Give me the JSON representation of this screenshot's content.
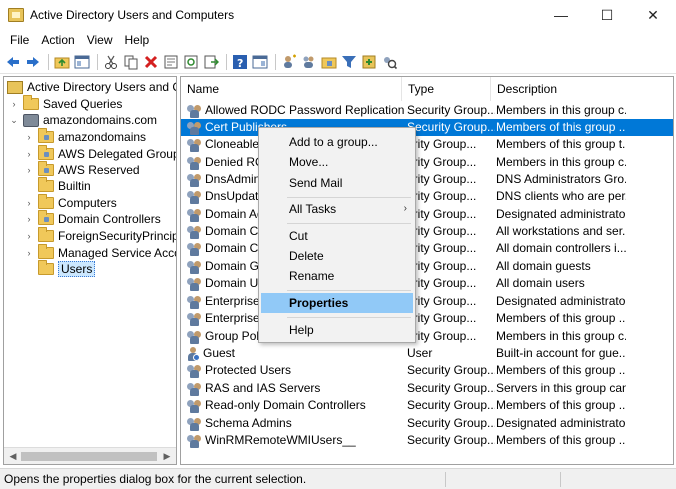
{
  "window": {
    "title": "Active Directory Users and Computers",
    "minimize": "—",
    "maximize": "☐",
    "close": "✕"
  },
  "menu": [
    "File",
    "Action",
    "View",
    "Help"
  ],
  "toolbar_icons": [
    "back-arrow-icon",
    "forward-arrow-icon",
    "up-folder-icon",
    "show-hide-tree-icon",
    "cut-icon",
    "copy-icon",
    "delete-icon",
    "properties-icon",
    "refresh-icon",
    "export-list-icon",
    "help-icon",
    "console-tree-icon",
    "new-user-icon",
    "new-group-icon",
    "new-ou-icon",
    "filter-icon",
    "add-to-group-icon",
    "find-icon"
  ],
  "tree": {
    "root": "Active Directory Users and Com",
    "items": [
      {
        "label": "Saved Queries"
      },
      {
        "label": "amazondomains.com"
      },
      {
        "label": "amazondomains"
      },
      {
        "label": "AWS Delegated Groups"
      },
      {
        "label": "AWS Reserved"
      },
      {
        "label": "Builtin"
      },
      {
        "label": "Computers"
      },
      {
        "label": "Domain Controllers"
      },
      {
        "label": "ForeignSecurityPrincipals"
      },
      {
        "label": "Managed Service Accour"
      },
      {
        "label": "Users"
      }
    ]
  },
  "list": {
    "columns": [
      "Name",
      "Type",
      "Description"
    ],
    "rows": [
      {
        "name": "Allowed RODC Password Replication Gr...",
        "type": "Security Group...",
        "desc": "Members in this group c..."
      },
      {
        "name": "Cert Publishers",
        "type": "Security Group...",
        "desc": "Members of this group ..."
      },
      {
        "name": "Cloneable D",
        "type": "urity Group...",
        "desc": "Members of this group t..."
      },
      {
        "name": "Denied ROD",
        "type": "urity Group...",
        "desc": "Members in this group c..."
      },
      {
        "name": "DnsAdmins",
        "type": "urity Group...",
        "desc": "DNS Administrators Gro..."
      },
      {
        "name": "DnsUpdateP",
        "type": "urity Group...",
        "desc": "DNS clients who are per..."
      },
      {
        "name": "Domain Adr",
        "type": "urity Group...",
        "desc": "Designated administrato..."
      },
      {
        "name": "Domain Cor",
        "type": "urity Group...",
        "desc": "All workstations and ser..."
      },
      {
        "name": "Domain Cor",
        "type": "urity Group...",
        "desc": "All domain controllers i..."
      },
      {
        "name": "Domain Gue",
        "type": "urity Group...",
        "desc": "All domain guests"
      },
      {
        "name": "Domain Use",
        "type": "urity Group...",
        "desc": "All domain users"
      },
      {
        "name": "Enterprise A",
        "type": "urity Group...",
        "desc": "Designated administrato..."
      },
      {
        "name": "Enterprise R",
        "type": "urity Group...",
        "desc": "Members of this group ..."
      },
      {
        "name": "Group Polic",
        "type": "urity Group...",
        "desc": "Members in this group c..."
      },
      {
        "name": "Guest",
        "type": "User",
        "desc": "Built-in account for gue..."
      },
      {
        "name": "Protected Users",
        "type": "Security Group...",
        "desc": "Members of this group ..."
      },
      {
        "name": "RAS and IAS Servers",
        "type": "Security Group...",
        "desc": "Servers in this group can..."
      },
      {
        "name": "Read-only Domain Controllers",
        "type": "Security Group...",
        "desc": "Members of this group ..."
      },
      {
        "name": "Schema Admins",
        "type": "Security Group...",
        "desc": "Designated administrato..."
      },
      {
        "name": "WinRMRemoteWMIUsers__",
        "type": "Security Group...",
        "desc": "Members of this group ..."
      }
    ]
  },
  "context_menu": {
    "items": [
      "Add to a group...",
      "Move...",
      "Send Mail",
      "All Tasks",
      "Cut",
      "Delete",
      "Rename",
      "Properties",
      "Help"
    ],
    "submenu_arrow": "›"
  },
  "statusbar": {
    "message": "Opens the properties dialog box for the current selection."
  },
  "scroll": {
    "left_arrow": "◀",
    "right_arrow": "▶"
  },
  "colors": {
    "selection": "#0078d7",
    "menu_highlight": "#91c9f7"
  }
}
